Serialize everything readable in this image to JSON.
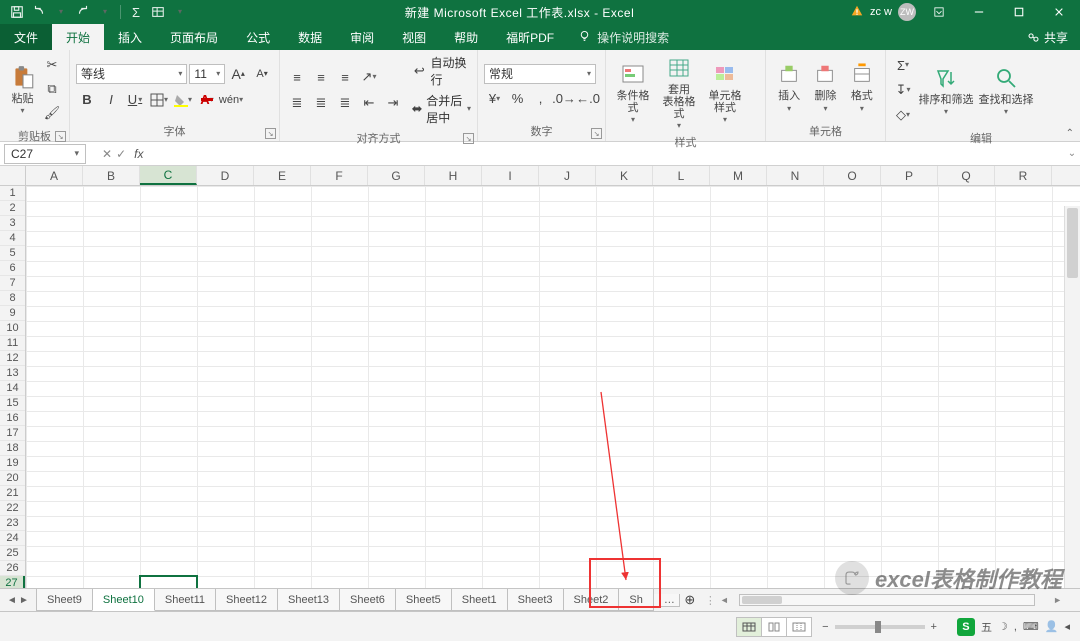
{
  "title": "新建 Microsoft Excel 工作表.xlsx  -  Excel",
  "user": {
    "name": "zc w",
    "initials": "ZW"
  },
  "tabs": {
    "file": "文件",
    "items": [
      "开始",
      "插入",
      "页面布局",
      "公式",
      "数据",
      "审阅",
      "视图",
      "帮助",
      "福昕PDF"
    ],
    "active": "开始",
    "tellme": "操作说明搜索",
    "share": "共享"
  },
  "groups": {
    "clipboard": {
      "label": "剪贴板",
      "paste": "粘贴"
    },
    "font": {
      "label": "字体",
      "name": "等线",
      "size": "11",
      "increase": "A",
      "decrease": "A"
    },
    "alignment": {
      "label": "对齐方式",
      "wrap": "自动换行",
      "merge": "合并后居中"
    },
    "number": {
      "label": "数字",
      "format": "常规",
      "percent": "%",
      "comma": ",",
      "currency": "¥"
    },
    "styles": {
      "label": "样式",
      "cond": "条件格式",
      "ftable": "套用\n表格格式",
      "cstyle": "单元格样式"
    },
    "cells": {
      "label": "单元格",
      "insert": "插入",
      "delete": "删除",
      "format": "格式"
    },
    "editing": {
      "label": "编辑",
      "sort": "排序和筛选",
      "find": "查找和选择"
    }
  },
  "fx": {
    "cell": "C27",
    "formula": ""
  },
  "columns": [
    "A",
    "B",
    "C",
    "D",
    "E",
    "F",
    "G",
    "H",
    "I",
    "J",
    "K",
    "L",
    "M",
    "N",
    "O",
    "P",
    "Q",
    "R"
  ],
  "rows": [
    "1",
    "2",
    "3",
    "4",
    "5",
    "6",
    "7",
    "8",
    "9",
    "10",
    "11",
    "12",
    "13",
    "14",
    "15",
    "16",
    "17",
    "18",
    "19",
    "20",
    "21",
    "22",
    "23",
    "24",
    "25",
    "26",
    "27"
  ],
  "selected": {
    "col": "C",
    "row": "27",
    "row_index": 26,
    "col_index": 2
  },
  "sheets": [
    "Sheet9",
    "Sheet10",
    "Sheet11",
    "Sheet12",
    "Sheet13",
    "Sheet6",
    "Sheet5",
    "Sheet1",
    "Sheet3",
    "Sheet2",
    "Sh"
  ],
  "active_sheet": "Sheet10",
  "status": {
    "ime": "五",
    "zoom": ""
  },
  "watermark": "excel表格制作教程"
}
